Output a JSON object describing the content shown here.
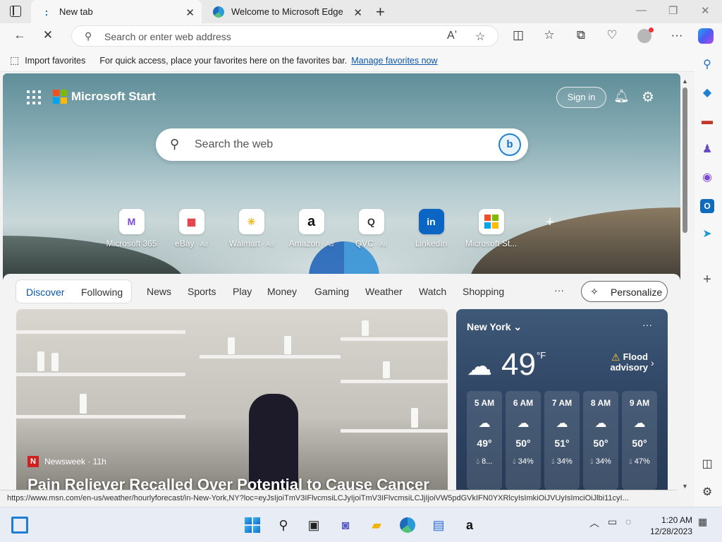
{
  "browser": {
    "tabs": [
      {
        "title": "New tab"
      },
      {
        "title": "Welcome to Microsoft Edge"
      }
    ],
    "address_placeholder": "Search or enter web address",
    "favorites_bar": {
      "import_label": "Import favorites",
      "message": "For quick access, place your favorites here on the favorites bar.",
      "manage_link": "Manage favorites now"
    },
    "status_url": "https://www.msn.com/en-us/weather/hourlyforecast/in-New-York,NY?loc=eyJsIjoiTmV3IFlvcmsiLCJyIjoiTmV3IFlvcmsiLCJjIjoiVW5pdGVkIFN0YXRlcyIsImkiOiJVUyIsImciOiJlbi11cyI..."
  },
  "start_page": {
    "brand": "Microsoft Start",
    "sign_in": "Sign in",
    "search_placeholder": "Search the web",
    "bing_label": "b",
    "quick_links": [
      {
        "label": "Microsoft 365",
        "ad": "",
        "icon": "M",
        "color": "#7b48d8"
      },
      {
        "label": "eBay",
        "ad": "· Ad",
        "icon": "▦",
        "color": "#e53238"
      },
      {
        "label": "Walmart",
        "ad": "· Ad",
        "icon": "✳",
        "color": "#0071ce"
      },
      {
        "label": "Amazon",
        "ad": "· Ad",
        "icon": "a",
        "color": "#111111"
      },
      {
        "label": "QVC",
        "ad": "· Ad",
        "icon": "Q",
        "color": "#333333"
      },
      {
        "label": "LinkedIn",
        "ad": "",
        "icon": "in",
        "color": "#0a66c2"
      },
      {
        "label": "Microsoft St...",
        "ad": "",
        "icon": "▦",
        "color": "#f25022"
      }
    ],
    "nav": {
      "discover": "Discover",
      "following": "Following",
      "links": [
        "News",
        "Sports",
        "Play",
        "Money",
        "Gaming",
        "Weather",
        "Watch",
        "Shopping"
      ],
      "more": "···",
      "personalize": "Personalize"
    },
    "news": {
      "source": "Newsweek · 11h",
      "source_badge": "N",
      "headline": "Pain Reliever Recalled Over Potential to Cause Cancer"
    },
    "weather": {
      "location": "New York",
      "temp": "49",
      "unit": "°F",
      "alert": "Flood advisory",
      "hours": [
        {
          "time": "5 AM",
          "temp": "49°",
          "precip": "8..."
        },
        {
          "time": "6 AM",
          "temp": "50°",
          "precip": "34%"
        },
        {
          "time": "7 AM",
          "temp": "51°",
          "precip": "34%"
        },
        {
          "time": "8 AM",
          "temp": "50°",
          "precip": "34%"
        },
        {
          "time": "9 AM",
          "temp": "50°",
          "precip": "47%"
        }
      ]
    }
  },
  "taskbar": {
    "time": "1:20 AM",
    "date": "12/28/2023"
  }
}
